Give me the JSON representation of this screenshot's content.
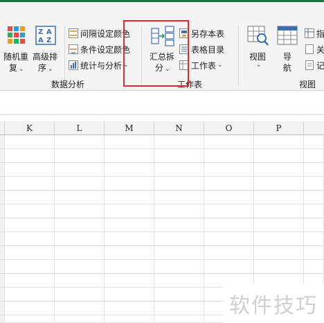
{
  "ribbon": {
    "random_button": {
      "line1": "随机重",
      "line2": "复"
    },
    "advanced_sort_button": {
      "line1": "高级排",
      "line2": "序"
    },
    "interval_color": "间隔设定颜色",
    "condition_color": "条件设定颜色",
    "stats_analysis": "统计与分析",
    "data_analysis_group": "数据分析",
    "summary_split": {
      "line1": "汇总拆",
      "line2": "分"
    },
    "save_as_sheet": "另存本表",
    "sheet_directory": "表格目录",
    "worksheet": "工作表",
    "worksheet_group": "工作表",
    "view_button": "视图",
    "nav_button": {
      "line1": "导",
      "line2": "航"
    },
    "view_group": "视图",
    "right_items": [
      "指",
      "关",
      "记"
    ]
  },
  "sheet": {
    "columns": [
      "K",
      "L",
      "M",
      "N",
      "O",
      "P"
    ]
  },
  "watermark": "软件技巧",
  "colors": {
    "accent": "#1e7145",
    "highlight": "#e02b2b"
  }
}
